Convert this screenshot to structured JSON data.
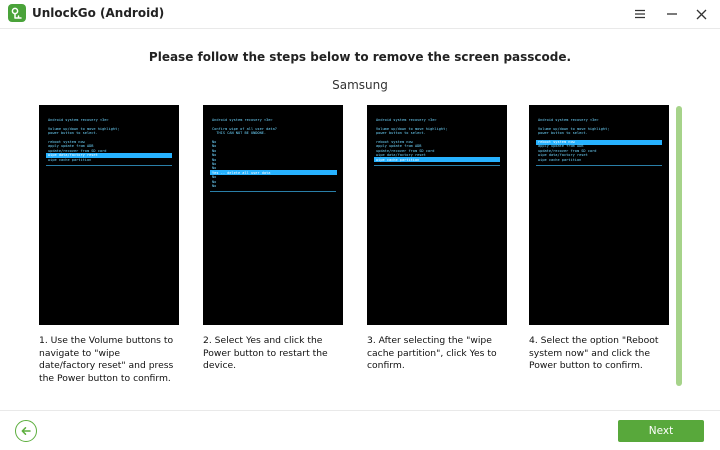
{
  "window": {
    "title": "UnlockGo (Android)",
    "icons": {
      "logo": "unlockgo-logo-icon",
      "menu": "hamburger-menu-icon",
      "minimize": "minimize-icon",
      "close": "close-icon"
    }
  },
  "page": {
    "heading": "Please follow the steps below to remove the screen passcode.",
    "brand": "Samsung"
  },
  "steps": [
    {
      "caption": "1. Use the Volume buttons to navigate to \"wipe date/factory reset\" and press the Power button to confirm.",
      "screen": {
        "header": [
          "Android system recovery <3e>",
          "",
          "Volume up/down to move highlight;",
          "power button to select."
        ],
        "menu": [
          "reboot system now",
          "apply update from ADB",
          "update/recover from SD card",
          "wipe data/factory reset",
          "wipe cache partition"
        ],
        "highlight": 3
      }
    },
    {
      "caption": "2. Select Yes and click the Power button to restart the device.",
      "screen": {
        "header": [
          "Android system recovery <3e>",
          "",
          "Confirm wipe of all user data?",
          "  THIS CAN NOT BE UNDONE."
        ],
        "menu": [
          "No",
          "No",
          "No",
          "No",
          "No",
          "No",
          "No",
          "Yes -- delete all user data",
          "No",
          "No",
          "No"
        ],
        "highlight": 7
      }
    },
    {
      "caption": "3. After selecting the \"wipe cache partition\", click Yes to confirm.",
      "screen": {
        "header": [
          "Android system recovery <3e>",
          "",
          "Volume up/down to move highlight;",
          "power button to select."
        ],
        "menu": [
          "reboot system now",
          "apply update from ADB",
          "update/recover from SD card",
          "wipe data/factory reset",
          "wipe cache partition"
        ],
        "highlight": 4
      }
    },
    {
      "caption": "4. Select the option \"Reboot system now\" and click the Power button to confirm.",
      "screen": {
        "header": [
          "Android system recovery <3e>",
          "",
          "Volume up/down to move highlight;",
          "power button to select."
        ],
        "menu": [
          "reboot system now",
          "apply update from ADB",
          "update/recover from SD card",
          "wipe data/factory reset",
          "wipe cache partition"
        ],
        "highlight": 0
      }
    }
  ],
  "footer": {
    "back_icon": "arrow-left-icon",
    "next_label": "Next"
  },
  "colors": {
    "accent": "#58a83b",
    "scroll_thumb": "#a6d38a",
    "screen_text": "#6fd6ff",
    "screen_highlight": "#27b2ff"
  }
}
